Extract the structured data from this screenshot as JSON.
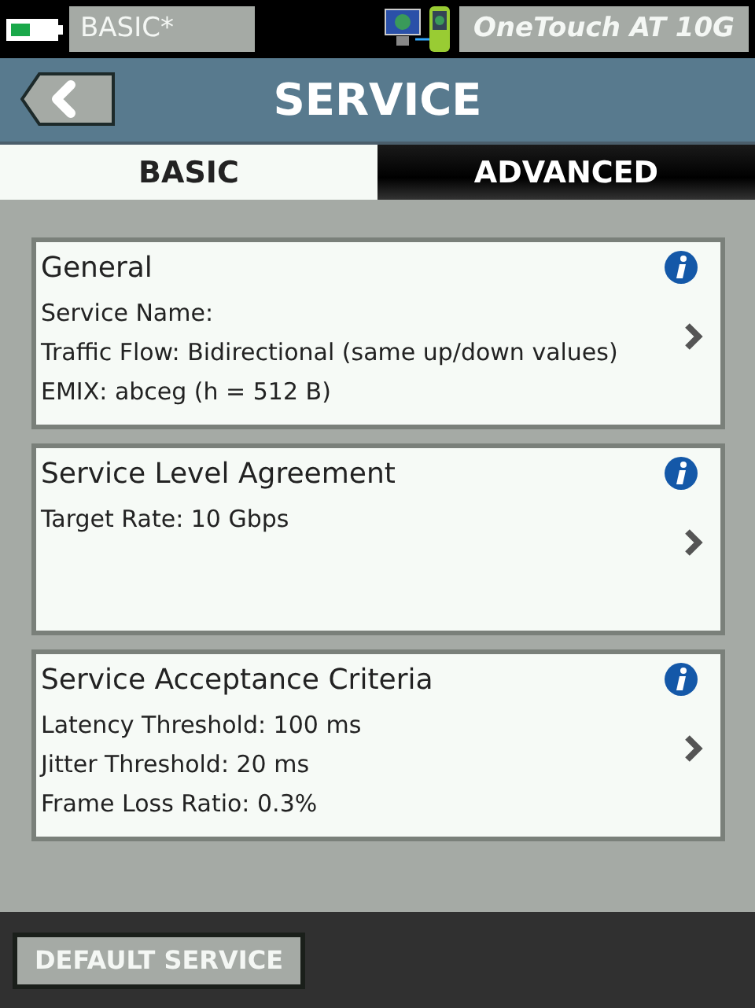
{
  "status_bar": {
    "profile": "BASIC*",
    "device": "OneTouch AT 10G"
  },
  "header": {
    "title": "SERVICE"
  },
  "tabs": [
    {
      "label": "BASIC",
      "selected": true
    },
    {
      "label": "ADVANCED",
      "selected": false
    }
  ],
  "cards": [
    {
      "title": "General",
      "lines": [
        "Service Name:",
        "Traffic Flow: Bidirectional (same up/down values)",
        "EMIX: abceg (h = 512 B)"
      ]
    },
    {
      "title": "Service Level Agreement",
      "lines": [
        "Target Rate: 10 Gbps"
      ]
    },
    {
      "title": "Service Acceptance Criteria",
      "lines": [
        "Latency Threshold: 100 ms",
        "Jitter Threshold: 20 ms",
        "Frame Loss Ratio: 0.3%"
      ]
    }
  ],
  "footer": {
    "button": "DEFAULT SERVICE"
  }
}
